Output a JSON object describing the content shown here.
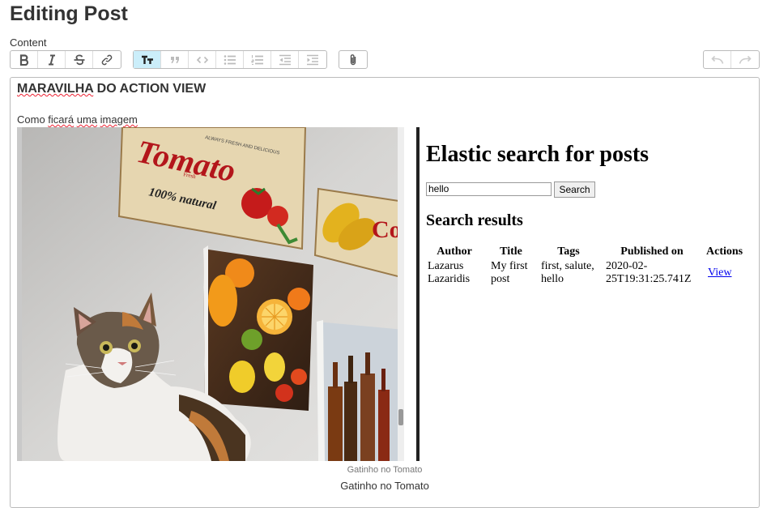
{
  "page": {
    "title": "Editing Post",
    "field_label": "Content"
  },
  "toolbar": {
    "text_tools": [
      "bold-icon",
      "italic-icon",
      "strikethrough-icon",
      "link-icon"
    ],
    "block_tools": [
      "heading-icon",
      "quote-icon",
      "code-icon",
      "bullet-list-icon",
      "numbered-list-icon",
      "outdent-icon",
      "indent-icon"
    ],
    "file_tools": [
      "attach-icon"
    ],
    "history_tools": [
      "undo-icon",
      "redo-icon"
    ],
    "accent_active": "#cbeefa"
  },
  "post": {
    "heading_words": [
      "MARAVILHA",
      " DO ACTION VIEW"
    ],
    "paragraph_words": [
      "Como ",
      "ficará",
      " ",
      "uma",
      " ",
      "imagem"
    ]
  },
  "photo": {
    "sign_text": "Tomato",
    "sign_tagline": "100% natural",
    "sign_small": "ALWAYS FRESH AND DELICIOUS",
    "sign_badge": "Fresh",
    "sign2_text": "Co"
  },
  "browser": {
    "title": "Elastic search for posts",
    "search_value": "hello",
    "search_button": "Search",
    "results_heading": "Search results",
    "table": {
      "headers": [
        "Author",
        "Title",
        "Tags",
        "Published on",
        "Actions"
      ],
      "rows": [
        {
          "author": "Lazarus Lazaridis",
          "title": "My first post",
          "tags": "first, salute, hello",
          "published": "2020-02-25T19:31:25.741Z",
          "action": "View"
        }
      ]
    }
  },
  "attachment": {
    "caption_small": "Gatinho no Tomato",
    "caption": "Gatinho no Tomato"
  }
}
